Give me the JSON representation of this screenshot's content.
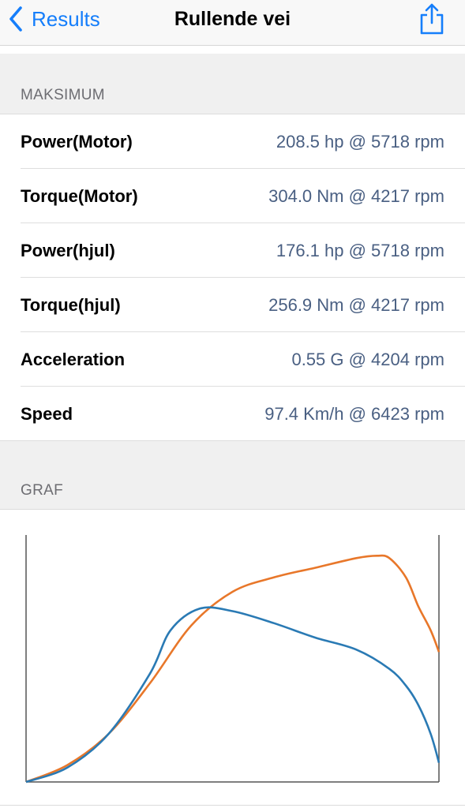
{
  "nav": {
    "back_label": "Results",
    "title": "Rullende vei",
    "icons": {
      "back": "chevron-left-icon",
      "share": "share-icon"
    },
    "accent_color": "#157efb"
  },
  "sections": {
    "maximum_header": "MAKSIMUM",
    "graph_header": "GRAF"
  },
  "maximum": [
    {
      "label": "Power(Motor)",
      "value": "208.5 hp @ 5718 rpm"
    },
    {
      "label": "Torque(Motor)",
      "value": "304.0 Nm @ 4217 rpm"
    },
    {
      "label": "Power(hjul)",
      "value": "176.1 hp @ 5718 rpm"
    },
    {
      "label": "Torque(hjul)",
      "value": "256.9 Nm @ 4217 rpm"
    },
    {
      "label": "Acceleration",
      "value": "0.55 G @ 4204 rpm"
    },
    {
      "label": "Speed",
      "value": "97.4 Km/h @ 6423 rpm"
    }
  ],
  "chart_data": {
    "type": "line",
    "title": "",
    "xlabel": "",
    "ylabel": "",
    "grid": false,
    "legend": "none",
    "xlim": [
      0,
      100
    ],
    "ylim": [
      0,
      100
    ],
    "series": [
      {
        "color": "#e8772a",
        "x": [
          0,
          10,
          20,
          30,
          40,
          50,
          60,
          70,
          80,
          85,
          88,
          92,
          95,
          98,
          100
        ],
        "y": [
          0,
          7,
          20,
          41,
          65,
          79,
          85,
          89,
          93,
          94,
          93,
          85,
          73,
          63,
          54
        ]
      },
      {
        "color": "#2a7ab4",
        "x": [
          0,
          10,
          20,
          30,
          35,
          42,
          50,
          60,
          70,
          80,
          88,
          92,
          95,
          98,
          100
        ],
        "y": [
          0,
          6,
          20,
          45,
          63,
          72,
          71,
          66,
          60,
          55,
          47,
          40,
          32,
          20,
          8
        ]
      }
    ]
  }
}
